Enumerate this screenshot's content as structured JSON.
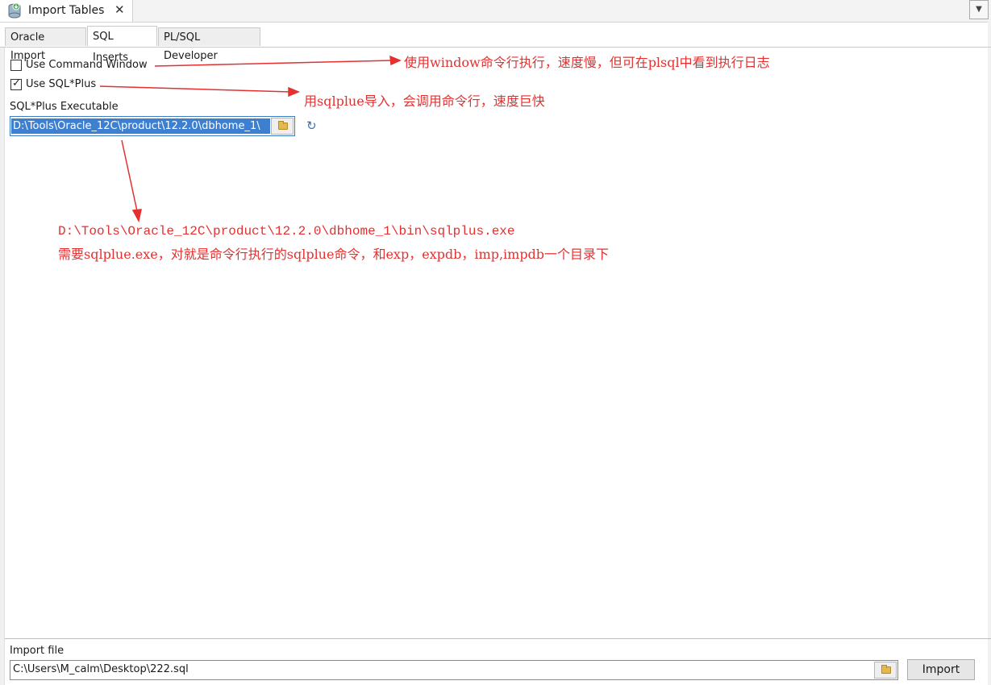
{
  "doc_tab": {
    "title": "Import Tables",
    "close_glyph": "✕",
    "dropdown_glyph": "▼"
  },
  "tabs": [
    {
      "label": "Oracle Import",
      "active": false
    },
    {
      "label": "SQL Inserts",
      "active": true
    },
    {
      "label": "PL/SQL Developer",
      "active": false
    }
  ],
  "options": {
    "use_command_window": {
      "label": "Use Command Window",
      "checked": false
    },
    "use_sqlplus": {
      "label": "Use SQL*Plus",
      "checked": true
    }
  },
  "sqlplus_executable": {
    "label": "SQL*Plus Executable",
    "value": "D:\\Tools\\Oracle_12C\\product\\12.2.0\\dbhome_1\\"
  },
  "refresh_glyph": "↻",
  "annotations": {
    "command_window_note": "使用window命令行执行，速度慢，但可在plsql中看到执行日志",
    "sqlplus_note": "用sqlplue导入，会调用命令行，速度巨快",
    "path_note": "D:\\Tools\\Oracle_12C\\product\\12.2.0\\dbhome_1\\bin\\sqlplus.exe",
    "path_explain": "需要sqlplue.exe，对就是命令行执行的sqlplue命令，和exp，expdb，imp,impdb一个目录下",
    "color": "#e53030"
  },
  "import_file": {
    "label": "Import file",
    "value": "C:\\Users\\M_calm\\Desktop\\222.sql"
  },
  "import_button": {
    "label": "Import"
  }
}
